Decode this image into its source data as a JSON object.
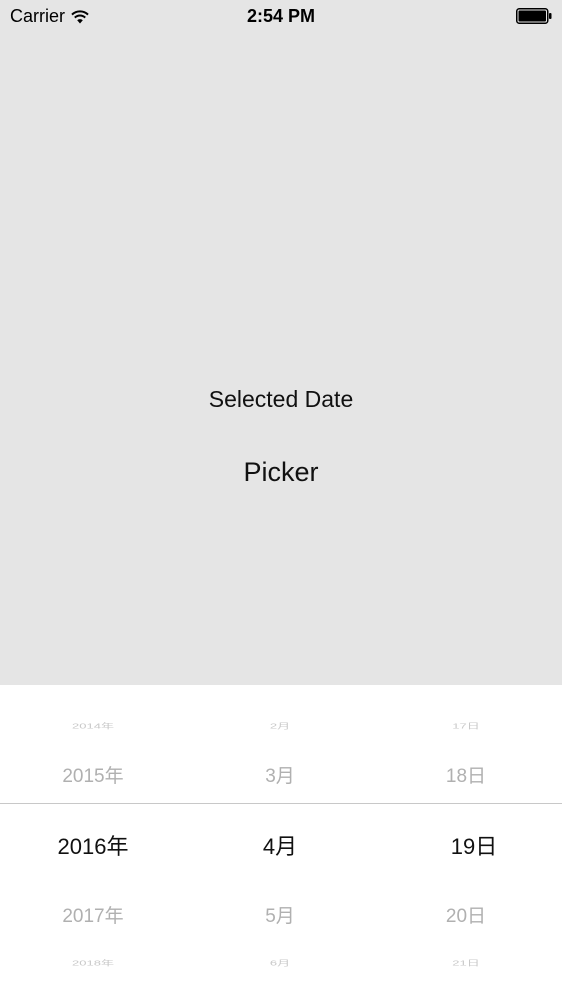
{
  "status_bar": {
    "carrier": "Carrier",
    "time": "2:54 PM"
  },
  "main": {
    "selected_date_label": "Selected Date",
    "picker_label": "Picker"
  },
  "date_picker": {
    "years": [
      "2014年",
      "2015年",
      "2016年",
      "2017年",
      "2018年"
    ],
    "months": [
      "2月",
      "3月",
      "4月",
      "5月",
      "6月"
    ],
    "days": [
      "17日",
      "18日",
      "19日",
      "20日",
      "21日"
    ],
    "selected": {
      "year": "2016年",
      "month": "4月",
      "day": "19日"
    }
  },
  "colors": {
    "background": "#e5e5e5",
    "picker_background": "#ffffff",
    "selected_text": "#111111",
    "unselected_text": "#b0b0b0"
  }
}
